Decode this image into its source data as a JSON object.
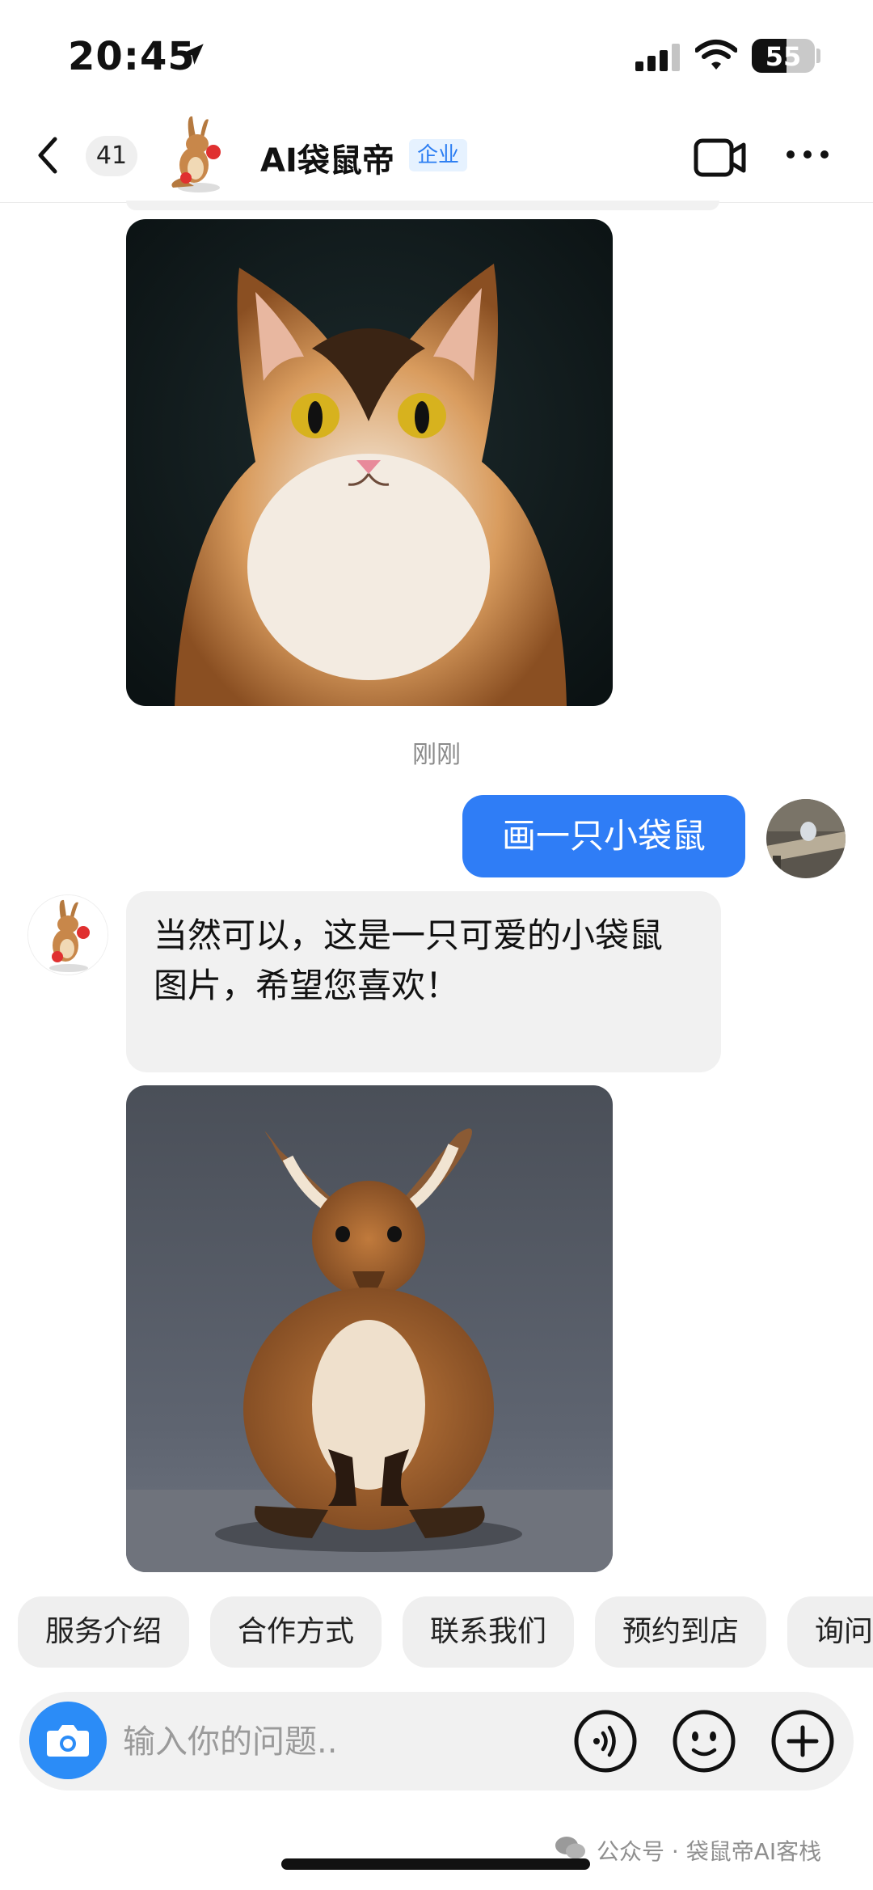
{
  "status_bar": {
    "time": "20:45",
    "battery_level": "55"
  },
  "header": {
    "unread_count": "41",
    "title": "AI袋鼠帝",
    "badge": "企业"
  },
  "chat": {
    "timestamp": "刚刚",
    "user_message": "画一只小袋鼠",
    "bot_message": "当然可以，这是一只可爱的小袋鼠图片，希望您喜欢！"
  },
  "quick_replies": [
    "服务介绍",
    "合作方式",
    "联系我们",
    "预约到店",
    "询问"
  ],
  "input": {
    "placeholder": "输入你的问题.."
  },
  "watermark": "公众号 · 袋鼠帝AI客栈",
  "colors": {
    "accent": "#2f7df6",
    "badge_bg": "#e6f2ff",
    "badge_text": "#2b7df2"
  }
}
